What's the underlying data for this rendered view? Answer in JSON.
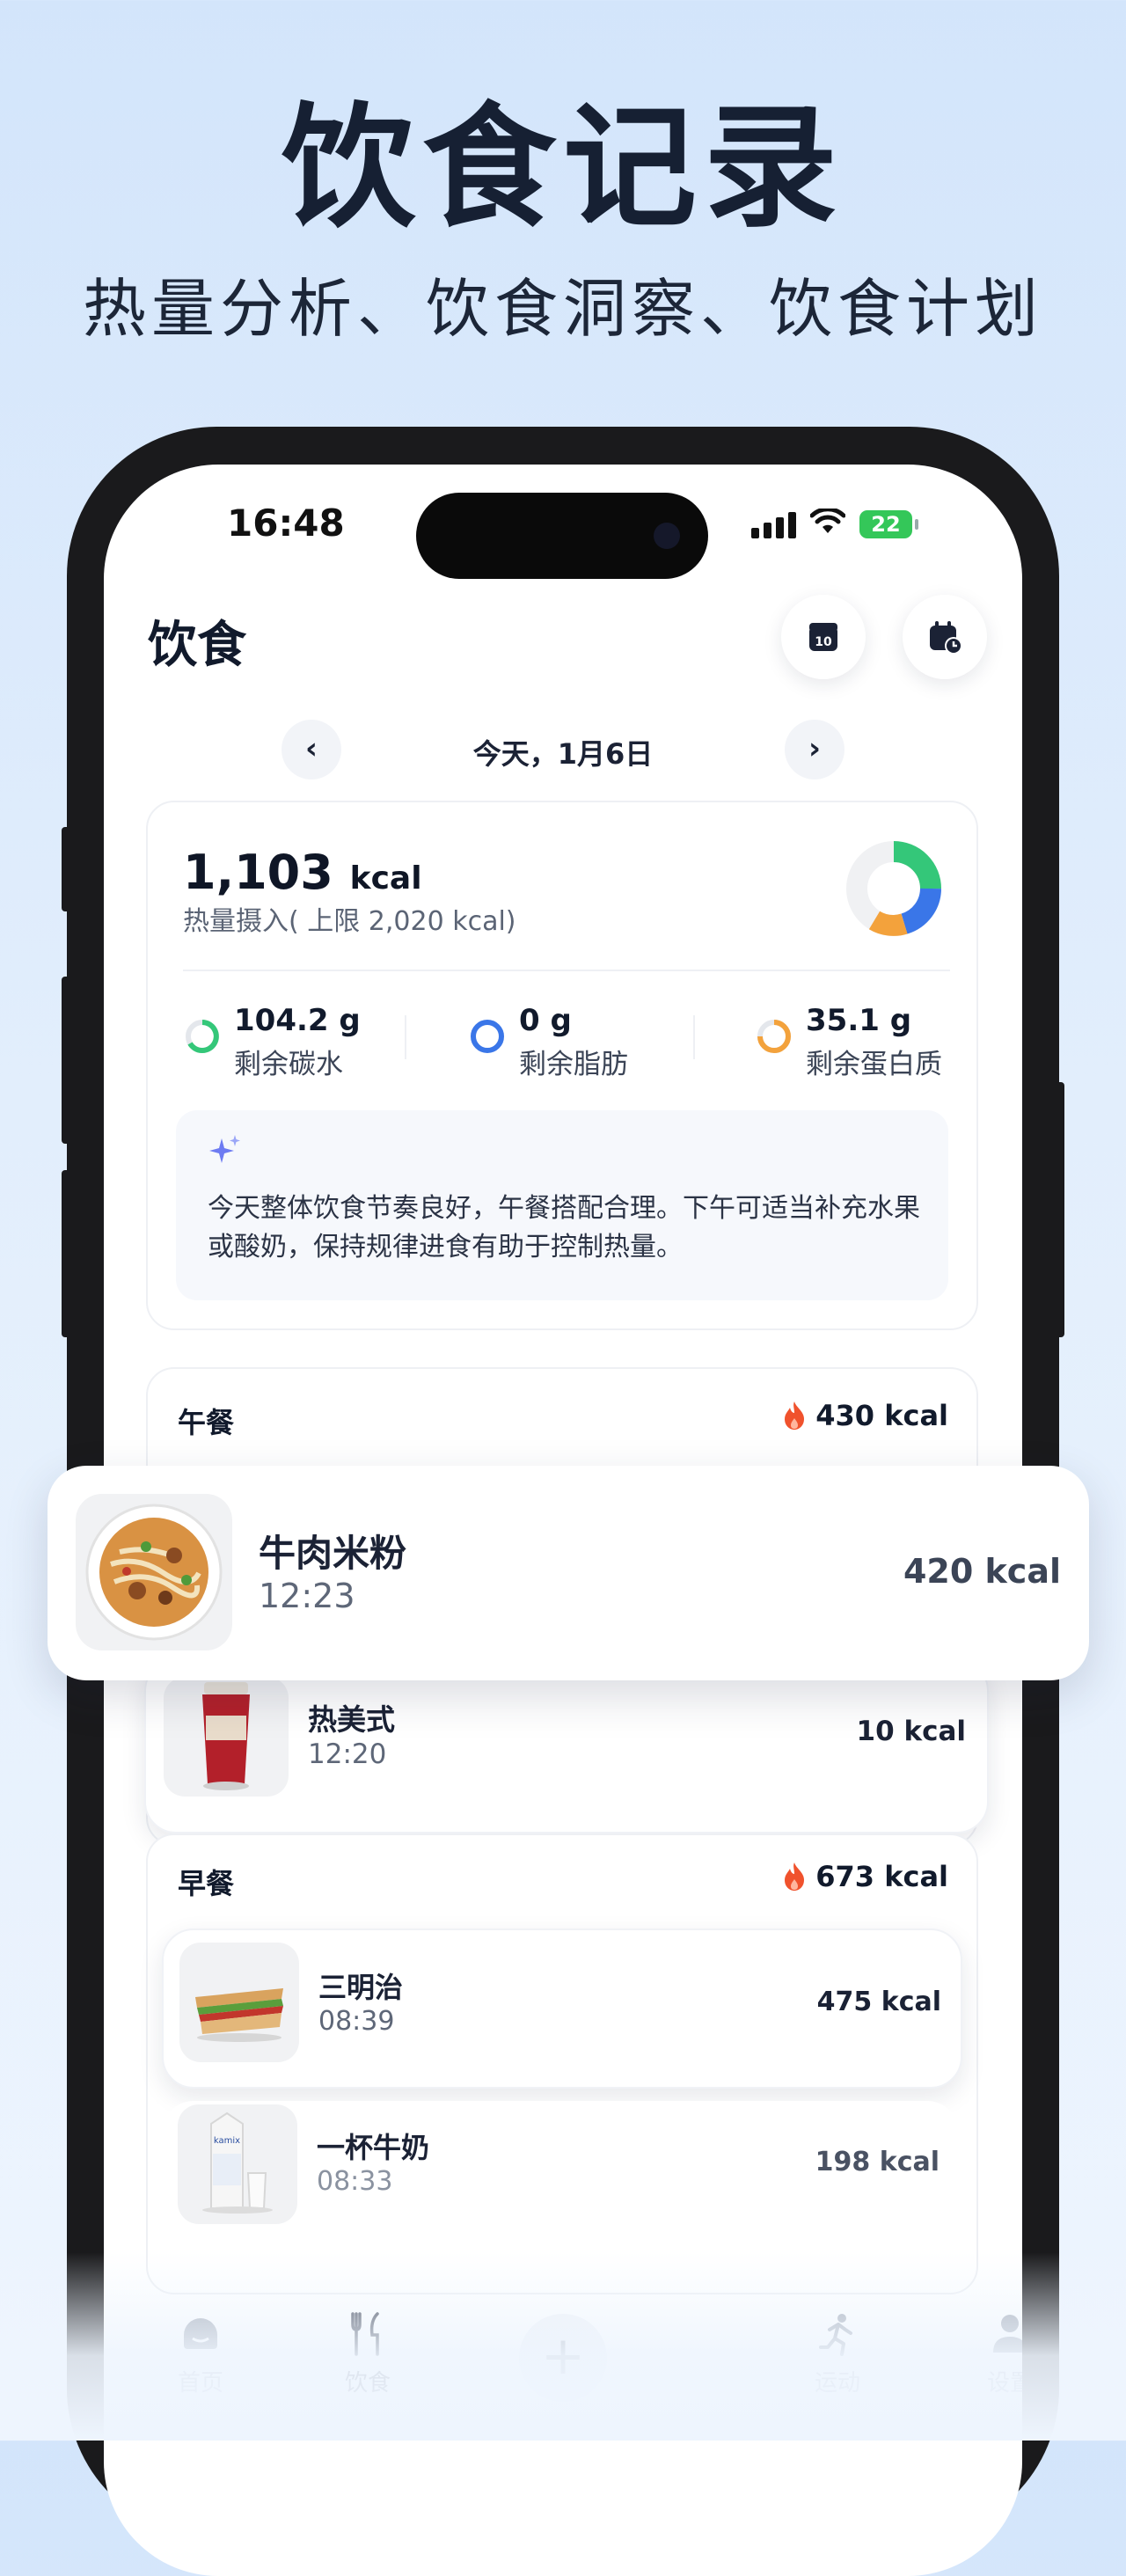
{
  "hero": {
    "title": "饮食记录",
    "subtitle": "热量分析、饮食洞察、饮食计划"
  },
  "status": {
    "time": "16:48",
    "battery": "22"
  },
  "header": {
    "title": "饮食",
    "calendar_badge": "10"
  },
  "date": {
    "label": "今天，1月6日",
    "prev": "‹",
    "next": "›"
  },
  "summary": {
    "kcal_value": "1,103",
    "kcal_unit": "kcal",
    "kcal_subtitle": "热量摄入( 上限 2,020 kcal)",
    "macros": [
      {
        "value": "104.2 g",
        "label": "剩余碳水",
        "color": "#34c779"
      },
      {
        "value": "0 g",
        "label": "剩余脂肪",
        "color": "#3a76e8"
      },
      {
        "value": "35.1 g",
        "label": "剩余蛋白质",
        "color": "#f3a23c"
      }
    ],
    "insight_icon": "sparkle-icon",
    "insight": "今天整体饮食节奏良好，午餐搭配合理。下午可适当补充水果或酸奶，保持规律进食有助于控制热量。"
  },
  "lunch": {
    "title": "午餐",
    "total": "430 kcal",
    "items": [
      {
        "name": "牛肉米粉",
        "time": "12:23",
        "kcal": "420 kcal"
      },
      {
        "name": "热美式",
        "time": "12:20",
        "kcal": "10 kcal"
      }
    ]
  },
  "breakfast": {
    "title": "早餐",
    "total": "673 kcal",
    "items": [
      {
        "name": "三明治",
        "time": "08:39",
        "kcal": "475 kcal"
      },
      {
        "name": "一杯牛奶",
        "time": "08:33",
        "kcal": "198 kcal",
        "carton_text": "kamix"
      }
    ]
  },
  "tabs": [
    {
      "label": "首页",
      "icon": "home-icon"
    },
    {
      "label": "饮食",
      "icon": "fork-knife-icon"
    },
    {
      "label": "+",
      "icon": "add-icon"
    },
    {
      "label": "运动",
      "icon": "run-icon"
    },
    {
      "label": "设置",
      "icon": "person-icon"
    }
  ],
  "colors": {
    "carbs": "#34c779",
    "fat": "#3a76e8",
    "protein": "#f3a23c",
    "flame": "#f0522d"
  }
}
